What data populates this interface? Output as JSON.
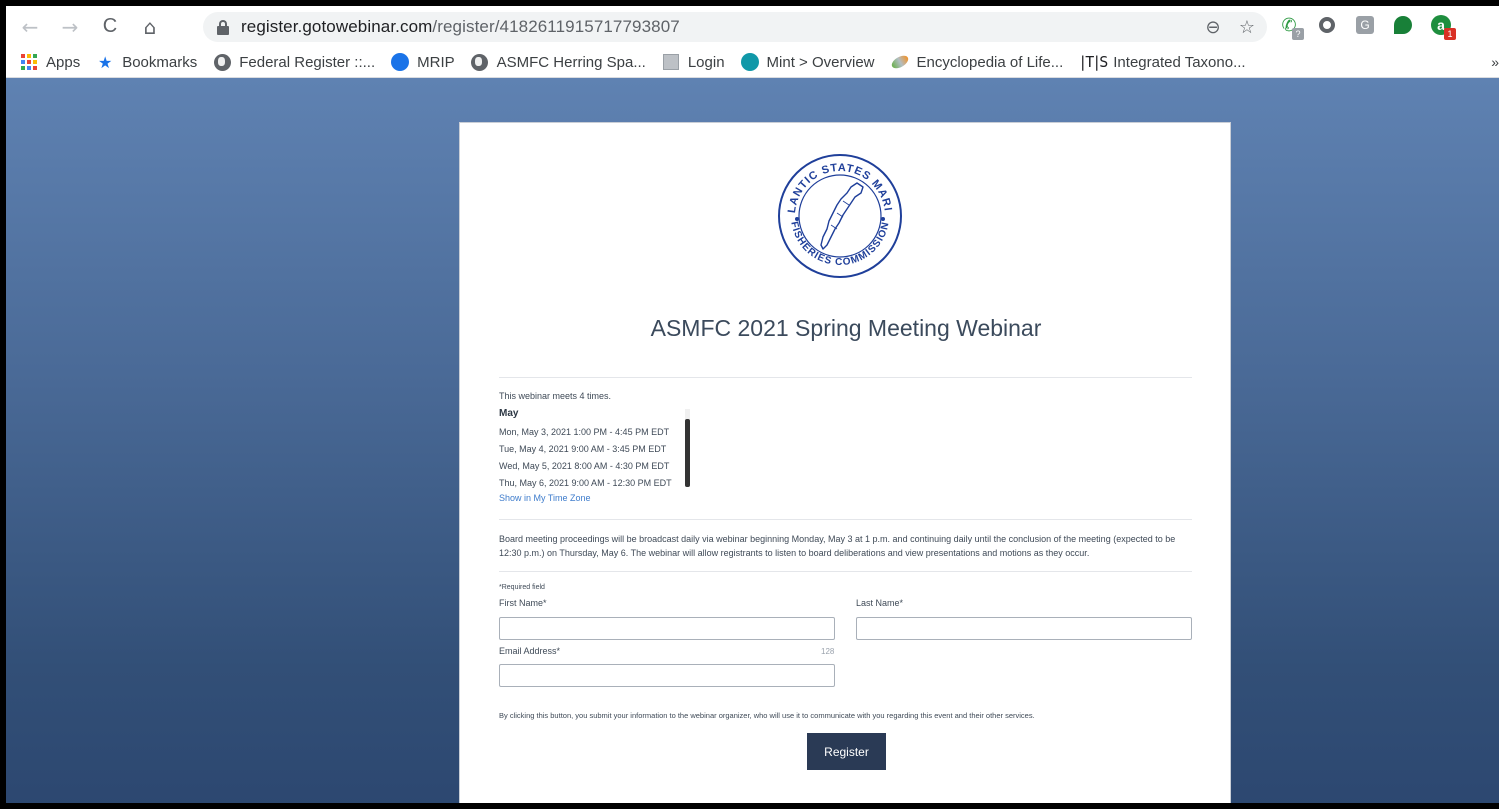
{
  "browser": {
    "url_host": "register.gotowebinar.com",
    "url_path": "/register/4182611915717793807",
    "nav": {
      "back": "←",
      "forward": "→",
      "reload": "C",
      "home": "⌂"
    },
    "omnibox_icons": {
      "zoom": "⊖",
      "star": "☆"
    },
    "extensions": {
      "phone_badge": "?",
      "g_label": "G",
      "a_label": "a",
      "a_badge": "1"
    }
  },
  "bookmarks": {
    "items": [
      {
        "label": "Apps",
        "icon": "apps-grid-icon"
      },
      {
        "label": "Bookmarks",
        "icon": "star-icon"
      },
      {
        "label": "Federal Register ::...",
        "icon": "globe-icon"
      },
      {
        "label": "MRIP",
        "icon": "noaa-icon"
      },
      {
        "label": "ASMFC Herring Spa...",
        "icon": "globe-icon"
      },
      {
        "label": "Login",
        "icon": "login-icon"
      },
      {
        "label": "Mint > Overview",
        "icon": "mint-icon"
      },
      {
        "label": "Encyclopedia of Life...",
        "icon": "eol-icon"
      },
      {
        "label": "Integrated Taxono...",
        "icon": "itis-icon"
      }
    ],
    "star_glyph": "★",
    "itis_glyph": "|T|S",
    "more": "»"
  },
  "logo": {
    "top_text": "ATLANTIC STATES MARINE",
    "bottom_text": "FISHERIES COMMISSION"
  },
  "webinar": {
    "title": "ASMFC 2021 Spring Meeting Webinar",
    "meets": "This webinar meets 4 times.",
    "month": "May",
    "sessions": [
      "Mon, May 3, 2021 1:00 PM - 4:45 PM EDT",
      "Tue,  May 4, 2021 9:00 AM - 3:45 PM EDT",
      "Wed, May 5, 2021 8:00 AM - 4:30 PM EDT",
      "Thu,  May 6, 2021 9:00 AM - 12:30 PM EDT"
    ],
    "timezone_link": "Show in My Time Zone",
    "description": "Board meeting proceedings will be broadcast daily via webinar beginning Monday, May 3 at  1 p.m. and continuing daily until the conclusion of the meeting (expected to be 12:30 p.m.) on Thursday, May 6. The webinar will allow registrants to listen to board deliberations and view presentations and motions as they occur."
  },
  "form": {
    "required_note": "*Required field",
    "first_name_label": "First Name*",
    "last_name_label": "Last Name*",
    "email_label": "Email Address*",
    "email_counter": "128",
    "first_name_value": "",
    "last_name_value": "",
    "email_value": "",
    "consent": "By clicking this button, you submit your information to the webinar organizer, who will use it to communicate with you regarding this event and their other services.",
    "register_label": "Register"
  },
  "colors": {
    "page_gradient_top": "#5f82b2",
    "page_gradient_bottom": "#2c4770",
    "button": "#2a3a55",
    "link": "#3e7ccc",
    "logo_blue": "#1f3f9a"
  }
}
